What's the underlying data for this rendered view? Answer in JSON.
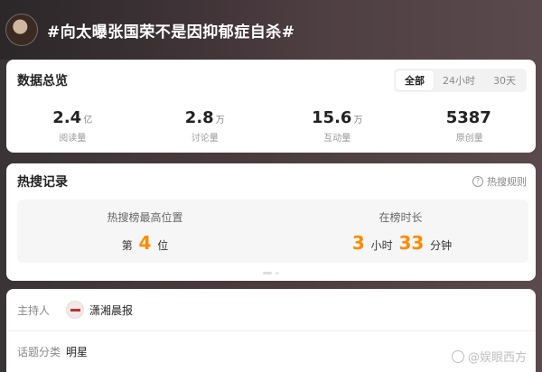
{
  "header": {
    "topic": "#向太曝张国荣不是因抑郁症自杀#"
  },
  "overview": {
    "title": "数据总览",
    "tabs": [
      {
        "label": "全部",
        "active": true
      },
      {
        "label": "24小时",
        "active": false
      },
      {
        "label": "30天",
        "active": false
      }
    ],
    "stats": [
      {
        "value": "2.4",
        "unit": "亿",
        "label": "阅读量"
      },
      {
        "value": "2.8",
        "unit": "万",
        "label": "讨论量"
      },
      {
        "value": "15.6",
        "unit": "万",
        "label": "互动量"
      },
      {
        "value": "5387",
        "unit": "",
        "label": "原创量"
      }
    ]
  },
  "hot": {
    "title": "热搜记录",
    "rules_label": "热搜规则",
    "peak": {
      "label": "热搜榜最高位置",
      "prefix": "第",
      "value": "4",
      "suffix": "位"
    },
    "duration": {
      "label": "在榜时长",
      "hours": "3",
      "hours_unit": "小时",
      "minutes": "33",
      "minutes_unit": "分钟"
    }
  },
  "info": {
    "host_label": "主持人",
    "host_name": "潇湘晨报",
    "category_label": "话题分类",
    "category_value": "明星"
  },
  "watermark": "@娱眼西方",
  "colors": {
    "accent": "#ff8a00"
  }
}
